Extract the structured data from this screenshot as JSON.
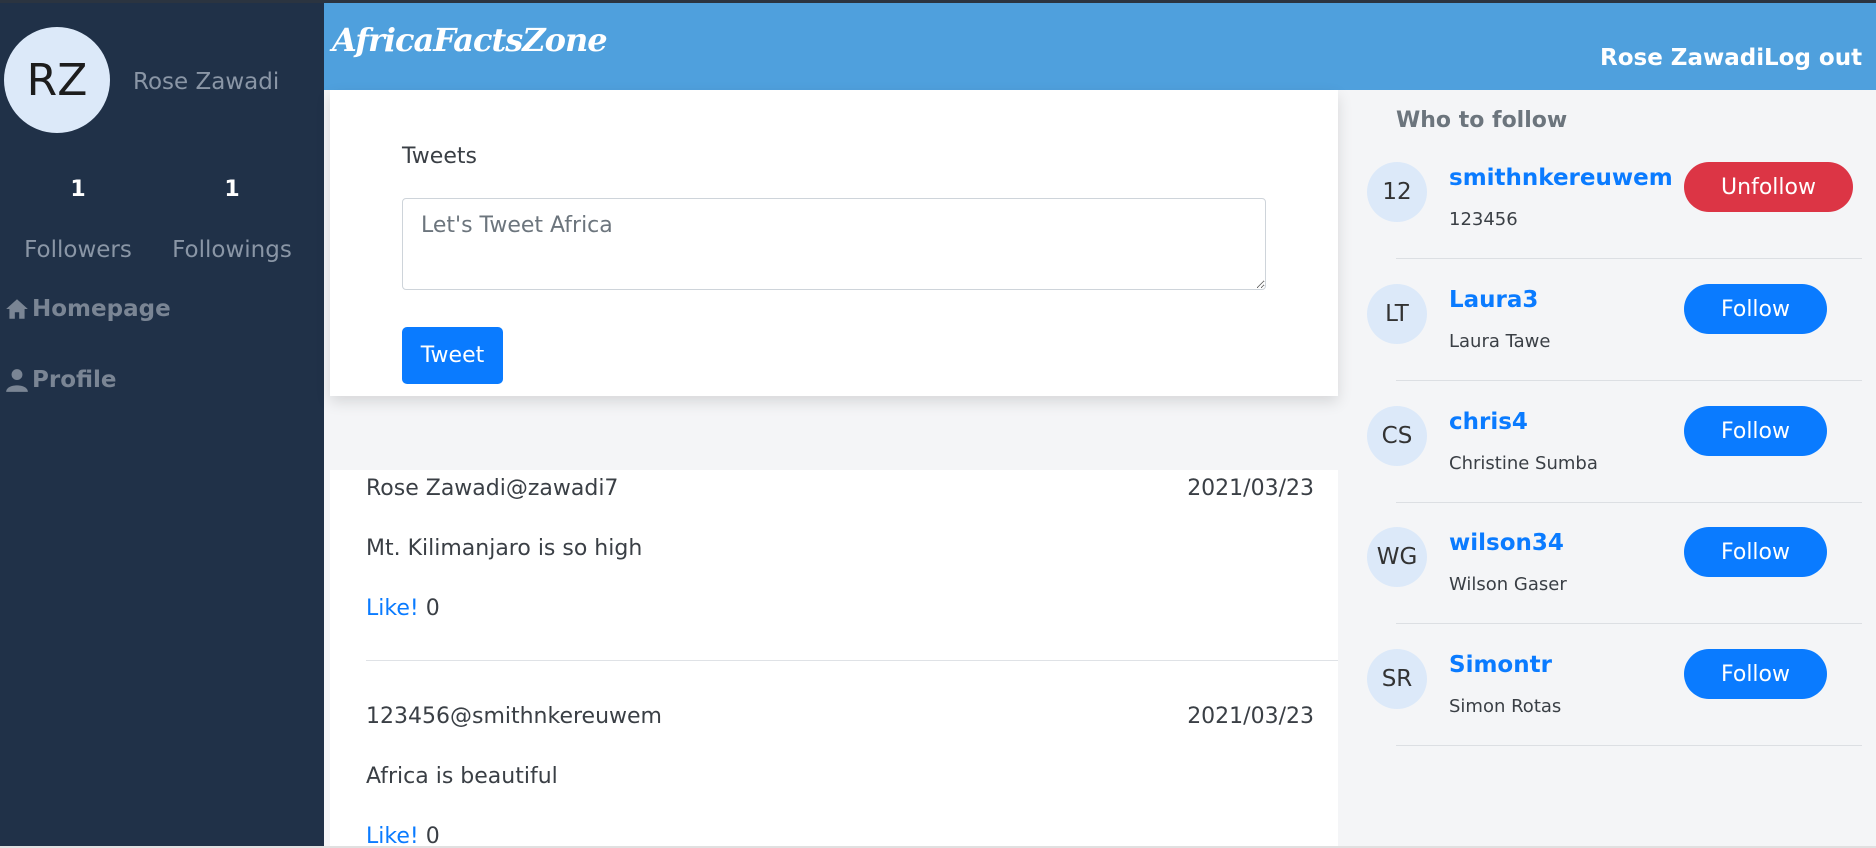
{
  "app": {
    "logo": "AfricaFactsZone"
  },
  "header": {
    "user_name": "Rose Zawadi",
    "logout_label": "Log out"
  },
  "sidebar": {
    "avatar_initials": "RZ",
    "user_name": "Rose Zawadi",
    "followers_count": "1",
    "followers_label": "Followers",
    "followings_count": "1",
    "followings_label": "Followings",
    "nav": [
      {
        "label": "Homepage",
        "icon": "home-icon"
      },
      {
        "label": "Profile",
        "icon": "user-icon"
      }
    ]
  },
  "compose": {
    "label": "Tweets",
    "placeholder": "Let's Tweet Africa",
    "button_label": "Tweet"
  },
  "feed": [
    {
      "author": "Rose Zawadi@zawadi7",
      "date": "2021/03/23",
      "text": "Mt. Kilimanjaro is so high",
      "like_label": "Like!",
      "likes": "0"
    },
    {
      "author": "123456@smithnkereuwem",
      "date": "2021/03/23",
      "text": "Africa is beautiful",
      "like_label": "Like!",
      "likes": "0"
    }
  ],
  "who_to_follow": {
    "title": "Who to follow",
    "users": [
      {
        "initials": "12",
        "username": "smithnkereuwem",
        "name": "123456",
        "action": "Unfollow"
      },
      {
        "initials": "LT",
        "username": "Laura3",
        "name": "Laura Tawe",
        "action": "Follow"
      },
      {
        "initials": "CS",
        "username": "chris4",
        "name": "Christine Sumba",
        "action": "Follow"
      },
      {
        "initials": "WG",
        "username": "wilson34",
        "name": "Wilson Gaser",
        "action": "Follow"
      },
      {
        "initials": "SR",
        "username": "Simontr",
        "name": "Simon Rotas",
        "action": "Follow"
      }
    ]
  },
  "colors": {
    "sidebar_bg": "#203148",
    "header_bg": "#4fa0dd",
    "primary": "#0a7bff",
    "danger": "#dc3545"
  }
}
